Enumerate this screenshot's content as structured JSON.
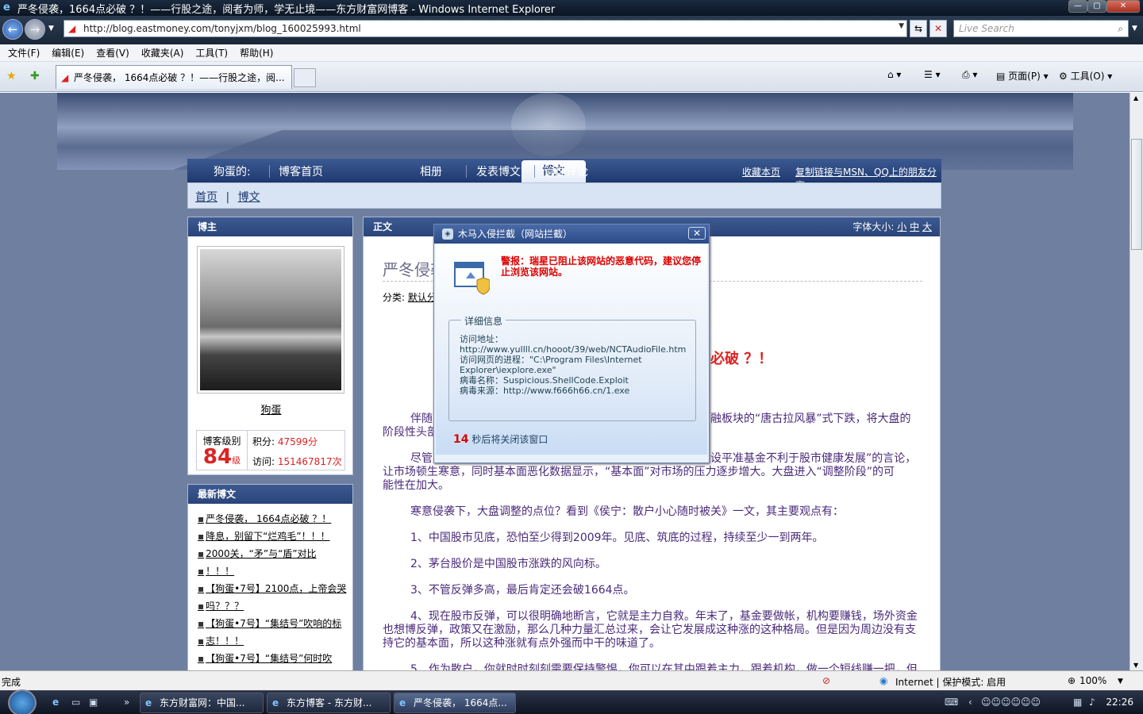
{
  "window": {
    "title": "严冬侵袭，1664点必破 ？！——行股之途，阅者为师，学无止境——东方财富网博客 - Windows Internet Explorer"
  },
  "addressbar": {
    "url": "http://blog.eastmoney.com/tonyjxm/blog_160025993.html",
    "search_placeholder": "Live Search"
  },
  "menu": [
    "文件(F)",
    "编辑(E)",
    "查看(V)",
    "收藏夹(A)",
    "工具(T)",
    "帮助(H)"
  ],
  "tab": {
    "label": "严冬侵袭， 1664点必破 ？！——行股之途，阅..."
  },
  "commandbar": {
    "page_label": "页面(P)",
    "tools_label": "工具(O)"
  },
  "blognav": {
    "owner": "狗蛋的:",
    "items": [
      "博客首页",
      "博文",
      "相册",
      "发表博文",
      "管理评论"
    ],
    "right_links": [
      "收藏本页",
      "复制链接与MSN、QQ上的朋友分享"
    ]
  },
  "subnav": {
    "home": "首页",
    "sep": "|",
    "current": "博文"
  },
  "profile": {
    "header": "博主",
    "name": "狗蛋",
    "level_label": "博客级别",
    "level": "84",
    "level_unit": "级",
    "points_label": "积分:",
    "points": "47599分",
    "visits_label": "访问:",
    "visits": "151467817次"
  },
  "latest": {
    "header": "最新博文",
    "items": [
      "严冬侵袭， 1664点必破 ？！",
      "降息，别留下“烂鸡毛”！！！",
      "2000关，“矛”与“盾”对比",
      "！！！",
      "【狗蛋•7号】2100点，上帝会哭",
      "吗？？？",
      "【狗蛋•7号】“集结号”吹响的标",
      "志！！！",
      "【狗蛋•7号】“集结号”何时吹"
    ]
  },
  "article": {
    "header": "正文",
    "font_size_label": "字体大小:",
    "font_sizes": [
      "小",
      "中",
      "大"
    ],
    "title_partial": "严冬侵袭",
    "category_label": "分类:",
    "category": "默认分",
    "big_title_partial": "必破 ？！",
    "paragraphs": [
      "伴随",
      "融板块的“唐古拉风暴”式下跌，将大盘的",
      "阶段性头部",
      "尽管",
      "设平准基金不利于股市健康发展”的言论，",
      "让市场顿生寒意，同时基本面恶化数据显示，“基本面”对市场的压力逐步增大。大盘进入“调整阶段”的可",
      "能性在加大。",
      "寒意侵袭下，大盘调整的点位？看到《侯宁：散户小心随时被关》一文，其主要观点有：",
      "1、中国股市见底，恐怕至少得到2009年。见底、筑底的过程，持续至少一到两年。",
      "2、茅台股价是中国股市涨跌的风向标。",
      "3、不管反弹多高，最后肯定还会破1664点。",
      "4、现在股市反弹，可以很明确地断言，它就是主力自救。年末了，基金要做帐，机构要赚钱，场外资金",
      "也想博反弹，政策又在激励，那么几种力量汇总过来，会让它发展成这种涨的这种格局。但是因为周边没有支",
      "持它的基本面，所以这种涨就有点外强而中干的味道了。",
      "5、作为散户，你就时时刻刻需要保持警惕，你可以在其中跟着主力，跟着机构，做一个短线赚一把，但"
    ]
  },
  "popup": {
    "title": "木马入侵拦截（网站拦截）",
    "warning": "警报：瑞星已阻止该网站的恶意代码，建议您停止浏览该网站。",
    "details_legend": "详细信息",
    "visit_label": "访问地址：",
    "visit_url": "http://www.yullll.cn/hooot/39/web/NCTAudioFile.htm",
    "process_label": "访问网页的进程：",
    "process": "\"C:\\Program Files\\Internet Explorer\\iexplore.exe\"",
    "virus_label": "病毒名称：",
    "virus": "Suspicious.ShellCode.Exploit",
    "source_label": "病毒来源：",
    "source": "http://www.f666h66.cn/1.exe",
    "countdown": "14",
    "countdown_text": "秒后将关闭该窗口"
  },
  "statusbar": {
    "status": "完成",
    "zone": "Internet | 保护模式: 启用",
    "zoom": "100%"
  },
  "taskbar": {
    "buttons": [
      "东方财富网：中国...",
      "东方博客 - 东方财...",
      "严冬侵袭， 1664点..."
    ],
    "clock": "22:26"
  }
}
